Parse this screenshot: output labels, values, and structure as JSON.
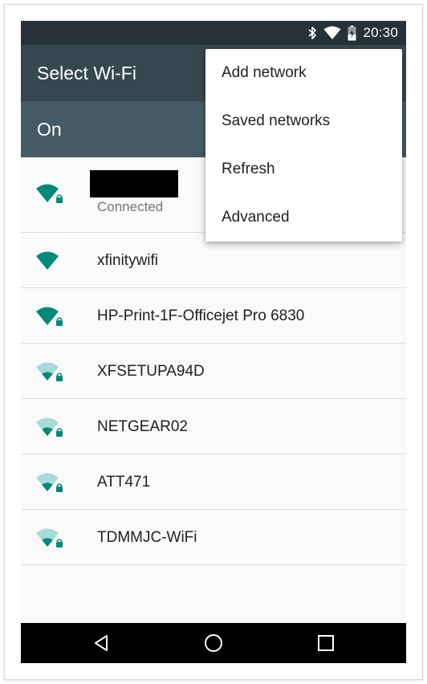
{
  "status_bar": {
    "time": "20:30",
    "icons": [
      "bluetooth-icon",
      "wifi-signal-icon",
      "battery-charging-icon"
    ]
  },
  "app_bar": {
    "title": "Select Wi-Fi"
  },
  "switch_bar": {
    "state_label": "On"
  },
  "networks": [
    {
      "name": "",
      "status": "Connected",
      "signal": "full",
      "secured": true,
      "icon": "wifi-lock-icon"
    },
    {
      "name": "xfinitywifi",
      "status": "",
      "signal": "full",
      "secured": false,
      "icon": "wifi-icon"
    },
    {
      "name": "HP-Print-1F-Officejet Pro 6830",
      "status": "",
      "signal": "full",
      "secured": true,
      "icon": "wifi-lock-icon"
    },
    {
      "name": "XFSETUPA94D",
      "status": "",
      "signal": "weak",
      "secured": true,
      "icon": "wifi-lock-icon"
    },
    {
      "name": "NETGEAR02",
      "status": "",
      "signal": "weak",
      "secured": true,
      "icon": "wifi-lock-icon"
    },
    {
      "name": "ATT471",
      "status": "",
      "signal": "weak",
      "secured": true,
      "icon": "wifi-lock-icon"
    },
    {
      "name": "TDMMJC-WiFi",
      "status": "",
      "signal": "weak",
      "secured": true,
      "icon": "wifi-lock-icon"
    }
  ],
  "overflow_menu": {
    "items": [
      "Add network",
      "Saved networks",
      "Refresh",
      "Advanced"
    ]
  },
  "nav_bar": {
    "buttons": [
      "back-icon",
      "home-icon",
      "recents-icon"
    ]
  },
  "colors": {
    "status_bar": "#263238",
    "app_bar": "#37474f",
    "switch_bar": "#455a64",
    "accent": "#00897b",
    "accent_light": "#a6dbd6"
  }
}
